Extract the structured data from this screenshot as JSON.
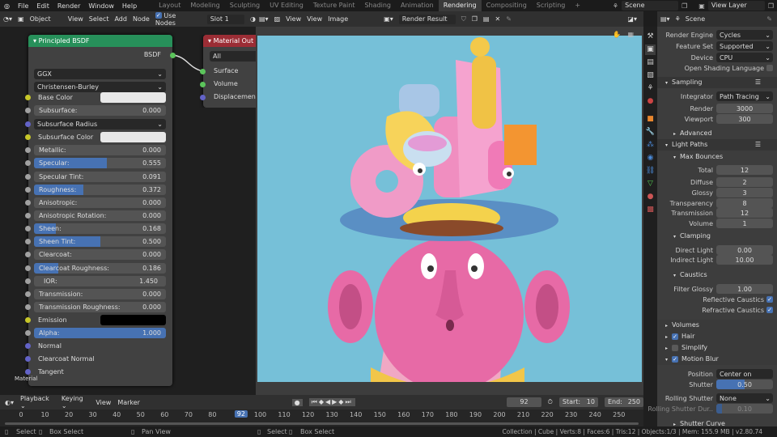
{
  "menu": [
    "File",
    "Edit",
    "Render",
    "Window",
    "Help"
  ],
  "workspaces": [
    "Layout",
    "Modeling",
    "Sculpting",
    "UV Editing",
    "Texture Paint",
    "Shading",
    "Animation",
    "Rendering",
    "Compositing",
    "Scripting",
    "+"
  ],
  "active_workspace": "Rendering",
  "scene": "Scene",
  "view_layer": "View Layer",
  "node_header": {
    "mode": "Object",
    "view": "View",
    "select": "Select",
    "add": "Add",
    "node": "Node",
    "use_nodes": "Use Nodes",
    "slot": "Slot 1"
  },
  "image_header": {
    "view": "View",
    "view2": "View",
    "image": "Image",
    "image_name": "Render Result"
  },
  "props_header": {
    "scene": "Scene"
  },
  "bsdf": {
    "title": "Principled BSDF",
    "output": "BSDF",
    "distribution": "GGX",
    "subsurface_method": "Christensen-Burley",
    "inputs": [
      {
        "label": "Base Color",
        "type": "color",
        "socket": "#c7c729",
        "color": "#e8e8e8"
      },
      {
        "label": "Subsurface:",
        "type": "slider",
        "value": "0.000",
        "fill": 0,
        "socket": "#a1a1a1"
      },
      {
        "label": "Subsurface Radius",
        "type": "select",
        "socket": "#6363c7"
      },
      {
        "label": "Subsurface Color",
        "type": "color",
        "socket": "#c7c729",
        "color": "#e8e8e8"
      },
      {
        "label": "Metallic:",
        "type": "slider",
        "value": "0.000",
        "fill": 0,
        "socket": "#a1a1a1"
      },
      {
        "label": "Specular:",
        "type": "slider",
        "value": "0.555",
        "fill": 0.555,
        "socket": "#a1a1a1"
      },
      {
        "label": "Specular Tint:",
        "type": "slider",
        "value": "0.091",
        "fill": 0,
        "socket": "#a1a1a1"
      },
      {
        "label": "Roughness:",
        "type": "slider",
        "value": "0.372",
        "fill": 0.372,
        "socket": "#a1a1a1"
      },
      {
        "label": "Anisotropic:",
        "type": "slider",
        "value": "0.000",
        "fill": 0,
        "socket": "#a1a1a1"
      },
      {
        "label": "Anisotropic Rotation:",
        "type": "slider",
        "value": "0.000",
        "fill": 0,
        "socket": "#a1a1a1"
      },
      {
        "label": "Sheen:",
        "type": "slider",
        "value": "0.168",
        "fill": 0.168,
        "socket": "#a1a1a1"
      },
      {
        "label": "Sheen Tint:",
        "type": "slider",
        "value": "0.500",
        "fill": 0.5,
        "socket": "#a1a1a1"
      },
      {
        "label": "Clearcoat:",
        "type": "slider",
        "value": "0.000",
        "fill": 0,
        "socket": "#a1a1a1"
      },
      {
        "label": "Clearcoat Roughness:",
        "type": "slider",
        "value": "0.186",
        "fill": 0.186,
        "socket": "#a1a1a1"
      },
      {
        "label": "IOR:",
        "type": "slider",
        "value": "1.450",
        "fill": 0,
        "socket": "#a1a1a1"
      },
      {
        "label": "Transmission:",
        "type": "slider",
        "value": "0.000",
        "fill": 0,
        "socket": "#a1a1a1"
      },
      {
        "label": "Transmission Roughness:",
        "type": "slider",
        "value": "0.000",
        "fill": 0,
        "socket": "#a1a1a1"
      },
      {
        "label": "Emission",
        "type": "color",
        "socket": "#c7c729",
        "color": "#000000"
      },
      {
        "label": "Alpha:",
        "type": "slider",
        "value": "1.000",
        "fill": 1,
        "socket": "#a1a1a1"
      },
      {
        "label": "Normal",
        "type": "plain",
        "socket": "#6363c7"
      },
      {
        "label": "Clearcoat Normal",
        "type": "plain",
        "socket": "#6363c7"
      },
      {
        "label": "Tangent",
        "type": "plain",
        "socket": "#6363c7"
      }
    ]
  },
  "material_output": {
    "title": "Material Out",
    "target": "All",
    "inputs": [
      "Surface",
      "Volume",
      "Displacement"
    ]
  },
  "node_tree_label": "Material",
  "properties": {
    "render_engine": {
      "label": "Render Engine",
      "value": "Cycles"
    },
    "feature_set": {
      "label": "Feature Set",
      "value": "Supported"
    },
    "device": {
      "label": "Device",
      "value": "CPU"
    },
    "osl": "Open Shading Language",
    "sampling": {
      "title": "Sampling",
      "integrator": {
        "label": "Integrator",
        "value": "Path Tracing"
      },
      "render": {
        "label": "Render",
        "value": "3000"
      },
      "viewport": {
        "label": "Viewport",
        "value": "300"
      },
      "advanced": "Advanced"
    },
    "light_paths": {
      "title": "Light Paths",
      "max_bounces": "Max Bounces",
      "bounces": [
        {
          "label": "Total",
          "value": "12"
        },
        {
          "label": "Diffuse",
          "value": "2"
        },
        {
          "label": "Glossy",
          "value": "3"
        },
        {
          "label": "Transparency",
          "value": "8"
        },
        {
          "label": "Transmission",
          "value": "12"
        },
        {
          "label": "Volume",
          "value": "1"
        }
      ],
      "clamping": "Clamping",
      "direct": {
        "label": "Direct Light",
        "value": "0.00"
      },
      "indirect": {
        "label": "Indirect Light",
        "value": "10.00"
      },
      "caustics": "Caustics",
      "filter_glossy": {
        "label": "Filter Glossy",
        "value": "1.00"
      },
      "reflective": "Reflective Caustics",
      "refractive": "Refractive Caustics"
    },
    "volumes": "Volumes",
    "hair": "Hair",
    "simplify": "Simplify",
    "motion_blur": "Motion Blur",
    "position": {
      "label": "Position",
      "value": "Center on Frame"
    },
    "shutter": {
      "label": "Shutter",
      "value": "0.50",
      "fill": 0.5
    },
    "rolling_shutter": {
      "label": "Rolling Shutter",
      "value": "None"
    },
    "rolling_dur": {
      "label": "Rolling Shutter Dur..",
      "value": "0.10",
      "fill": 0.1
    },
    "shutter_curve": "Shutter Curve"
  },
  "timeline": {
    "playback": "Playback",
    "keying": "Keying",
    "view": "View",
    "marker": "Marker",
    "current_frame": "92",
    "start_label": "Start:",
    "start": "10",
    "end_label": "End:",
    "end": "250",
    "ticks": [
      "0",
      "10",
      "20",
      "30",
      "40",
      "50",
      "60",
      "70",
      "80",
      "92",
      "100",
      "110",
      "120",
      "130",
      "140",
      "150",
      "160",
      "170",
      "180",
      "190",
      "200",
      "210",
      "220",
      "230",
      "240",
      "250"
    ]
  },
  "status": {
    "select": "Select",
    "box_select": "Box Select",
    "pan_view": "Pan View",
    "select2": "Select",
    "box_select2": "Box Select",
    "info": "Collection | Cube | Verts:8 | Faces:6 | Tris:12 | Objects:1/3 | Mem: 155.9 MB | v2.80.74"
  }
}
